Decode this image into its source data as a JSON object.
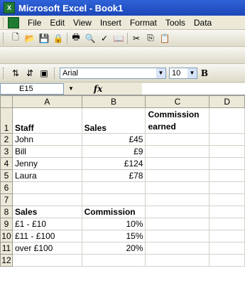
{
  "window": {
    "title": "Microsoft Excel - Book1",
    "app_icon": "X"
  },
  "menu": [
    "File",
    "Edit",
    "View",
    "Insert",
    "Format",
    "Tools",
    "Data"
  ],
  "toolbar2": {
    "font_name": "Arial",
    "font_size": "10",
    "bold_label": "B"
  },
  "formula_bar": {
    "name_box": "E15",
    "fx_label": "fx",
    "formula": ""
  },
  "sheet": {
    "columns": [
      "A",
      "B",
      "C",
      "D"
    ],
    "rows": [
      {
        "num": "1",
        "a": "Staff",
        "b": "Sales",
        "c": "Commission earned"
      },
      {
        "num": "2",
        "a": "John",
        "b": "£45",
        "c": ""
      },
      {
        "num": "3",
        "a": "Bill",
        "b": "£9",
        "c": ""
      },
      {
        "num": "4",
        "a": "Jenny",
        "b": "£124",
        "c": ""
      },
      {
        "num": "5",
        "a": "Laura",
        "b": "£78",
        "c": ""
      },
      {
        "num": "6",
        "a": "",
        "b": "",
        "c": ""
      },
      {
        "num": "7",
        "a": "",
        "b": "",
        "c": ""
      },
      {
        "num": "8",
        "a": "Sales",
        "b": "Commission",
        "c": ""
      },
      {
        "num": "9",
        "a": "£1 - £10",
        "b": "10%",
        "c": ""
      },
      {
        "num": "10",
        "a": "£11 - £100",
        "b": "15%",
        "c": ""
      },
      {
        "num": "11",
        "a": "over £100",
        "b": "20%",
        "c": ""
      },
      {
        "num": "12",
        "a": "",
        "b": "",
        "c": ""
      }
    ]
  }
}
